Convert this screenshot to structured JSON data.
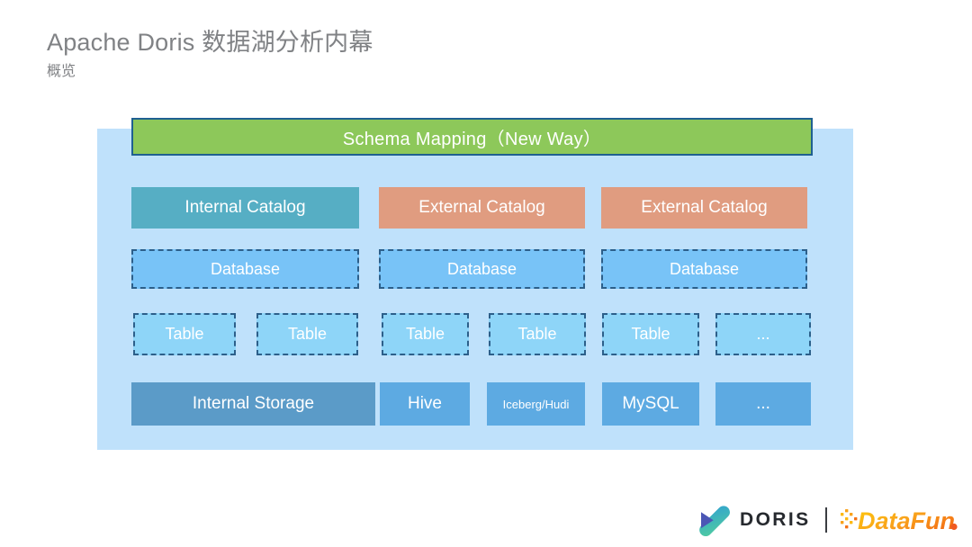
{
  "header": {
    "title": "Apache Doris 数据湖分析内幕",
    "subtitle": "概览"
  },
  "diagram": {
    "banner": {
      "label": "Schema Mapping（New Way）",
      "fill": "#8dc85a",
      "border": "#1f6091"
    },
    "catalog_row": [
      {
        "label": "Internal Catalog",
        "fill": "#56aec4"
      },
      {
        "label": "External Catalog",
        "fill": "#e09c80"
      },
      {
        "label": "External Catalog",
        "fill": "#e09c80"
      }
    ],
    "database_row": [
      {
        "label": "Database",
        "fill": "#78c3f7"
      },
      {
        "label": "Database",
        "fill": "#78c3f7"
      },
      {
        "label": "Database",
        "fill": "#78c3f7"
      }
    ],
    "table_row": [
      {
        "label": "Table"
      },
      {
        "label": "Table"
      },
      {
        "label": "Table"
      },
      {
        "label": "Table"
      },
      {
        "label": "Table"
      },
      {
        "label": "..."
      }
    ],
    "storage_row": [
      {
        "label": "Internal Storage",
        "fill": "#5b9bc8"
      },
      {
        "label": "Hive",
        "fill": "#5daae2"
      },
      {
        "label": "Iceberg/Hudi",
        "fill": "#5daae2"
      },
      {
        "label": "MySQL",
        "fill": "#5daae2"
      },
      {
        "label": "...",
        "fill": "#5daae2"
      }
    ],
    "panel_fill": "#bfe1fb"
  },
  "footer": {
    "doris_wordmark": "DORIS",
    "datafun_wordmark": "DataFun.",
    "doris_logo_colors": [
      "#4b56b5",
      "#2f9fd4",
      "#4ec9a3"
    ],
    "datafun_logo_colors": [
      "#f9a21b",
      "#f05a22",
      "#fdc70c"
    ]
  }
}
